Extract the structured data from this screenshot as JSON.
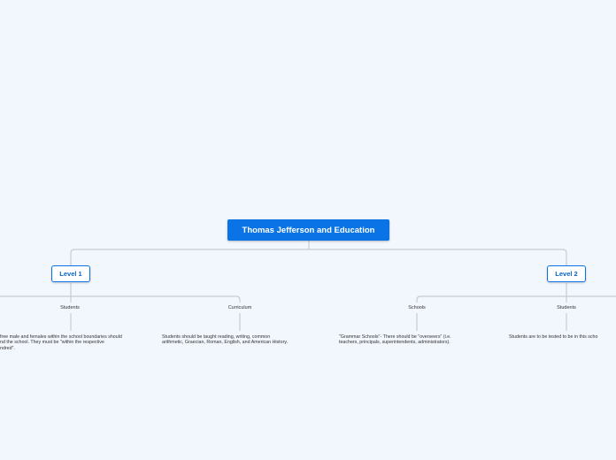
{
  "mindmap": {
    "root": {
      "label": "Thomas Jefferson and Education"
    },
    "level1": {
      "label": "Level 1",
      "students": {
        "label": "Students",
        "note": "free male and females within the school boundaries should\nnd the school. They must be \"within the respective\nndred\"."
      },
      "curriculum": {
        "label": "Curriculum",
        "note": "Students should be taught reading, writing, common\narithmetic, Graecian, Roman, English, and American History."
      }
    },
    "level2": {
      "label": "Level 2",
      "schools": {
        "label": "Schools",
        "note": "\"Grammar Schools\"- There should be \"overseers\" (i.e.\nteachers, principals, superintendents, administrators)."
      },
      "students": {
        "label": "Students",
        "note": "Students are to be tested to be in this scho"
      }
    }
  },
  "colors": {
    "background": "#f2f6fd",
    "root_fill": "#0a74e6",
    "level_border": "#0a74e6",
    "connector": "#c5ccd6"
  }
}
